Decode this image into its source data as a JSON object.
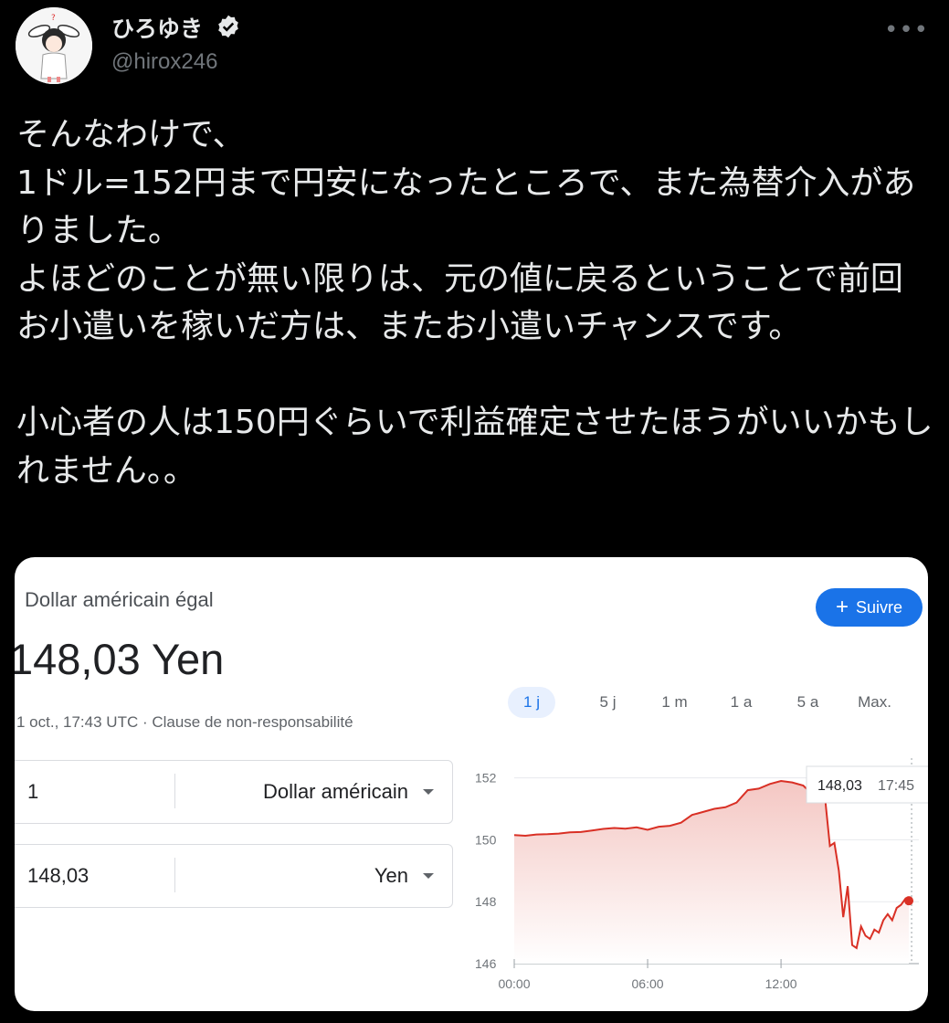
{
  "user": {
    "name": "ひろゆき",
    "handle": "@hirox246"
  },
  "tweet": {
    "text": "そんなわけで、\n1ドル=152円まで円安になったところで、また為替介入がありました。\nよほどのことが無い限りは、元の値に戻るということで前回お小遣いを稼いだ方は、またお小遣いチャンスです。\n\n小心者の人は150円ぐらいで利益確定させたほうがいいかもしれません。。"
  },
  "card": {
    "subtitle": "Dollar américain égal",
    "rate": "148,03 Yen",
    "time": "1 oct., 17:43 UTC",
    "separator": " · ",
    "disclaimer": "Clause de non-responsabilité",
    "follow_label": "Suivre",
    "converter": [
      {
        "value": "1",
        "unit": "Dollar américain"
      },
      {
        "value": "148,03",
        "unit": "Yen"
      }
    ],
    "tabs": [
      "1 j",
      "5 j",
      "1 m",
      "1 a",
      "5 a",
      "Max."
    ],
    "active_tab": "1 j"
  },
  "colors": {
    "accent": "#1a73e8",
    "line": "#d93025",
    "verified": "#e7e9ea"
  },
  "chart_data": {
    "type": "area",
    "yticks": [
      "146",
      "148",
      "150",
      "152"
    ],
    "xticks": [
      "00:00",
      "06:00",
      "12:00"
    ],
    "ylim": [
      146,
      152.4
    ],
    "tooltip": {
      "value": "148,03",
      "time": "17:45"
    },
    "x_hours": [
      0,
      0.5,
      1,
      1.5,
      2,
      2.5,
      3,
      3.5,
      4,
      4.5,
      5,
      5.5,
      6,
      6.5,
      7,
      7.5,
      8,
      8.5,
      9,
      9.5,
      10,
      10.5,
      11,
      11.5,
      12,
      12.5,
      13,
      13.5,
      14,
      14.2,
      14.4,
      14.6,
      14.8,
      15.0,
      15.2,
      15.4,
      15.6,
      15.8,
      16.0,
      16.2,
      16.4,
      16.6,
      16.8,
      17.0,
      17.2,
      17.4,
      17.6,
      17.75
    ],
    "values": [
      150.15,
      150.13,
      150.17,
      150.18,
      150.2,
      150.24,
      150.25,
      150.3,
      150.35,
      150.38,
      150.36,
      150.4,
      150.32,
      150.42,
      150.45,
      150.55,
      150.8,
      150.9,
      151.0,
      151.05,
      151.2,
      151.6,
      151.65,
      151.8,
      151.9,
      151.85,
      151.75,
      151.4,
      151.2,
      149.8,
      149.9,
      149.0,
      147.5,
      148.5,
      146.6,
      146.5,
      147.2,
      146.9,
      146.8,
      147.1,
      147.0,
      147.4,
      147.6,
      147.4,
      147.8,
      147.9,
      148.1,
      148.03
    ]
  }
}
